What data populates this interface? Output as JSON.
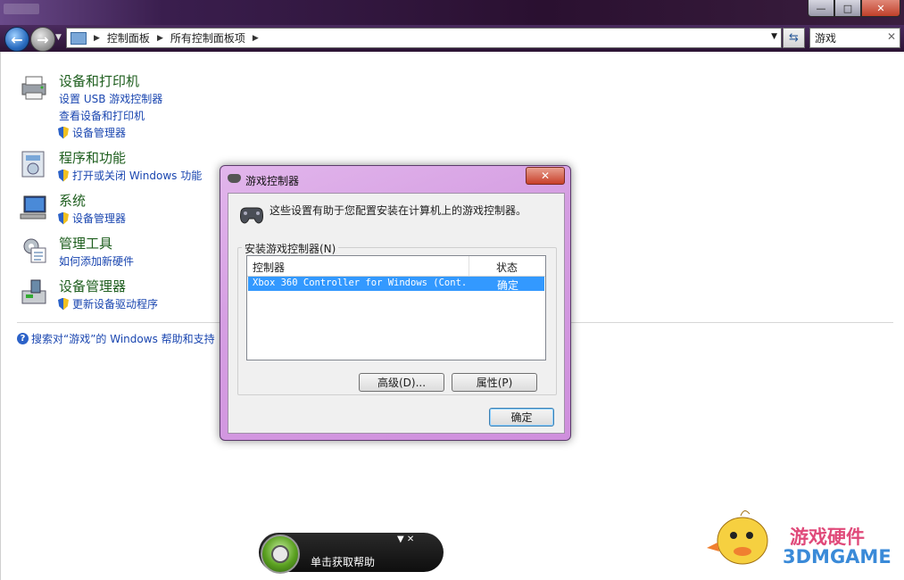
{
  "window": {
    "controls": {
      "minimize": "—",
      "maximize": "□",
      "close": "✕"
    }
  },
  "nav": {
    "back_icon": "back-arrow-icon",
    "forward_icon": "forward-arrow-icon",
    "breadcrumbs": [
      "控制面板",
      "所有控制面板项"
    ],
    "search_value": "游戏"
  },
  "categories": [
    {
      "title": "设备和打印机",
      "icon": "printer-icon",
      "links": [
        {
          "text": "设置 USB 游戏控制器",
          "shield": false
        },
        {
          "text": "查看设备和打印机",
          "shield": false
        },
        {
          "text": "设备管理器",
          "shield": true
        }
      ]
    },
    {
      "title": "程序和功能",
      "icon": "programs-icon",
      "links": [
        {
          "text": "打开或关闭 Windows 功能",
          "shield": true
        }
      ]
    },
    {
      "title": "系统",
      "icon": "computer-icon",
      "links": [
        {
          "text": "设备管理器",
          "shield": true
        }
      ]
    },
    {
      "title": "管理工具",
      "icon": "admin-tools-icon",
      "links": [
        {
          "text": "如何添加新硬件",
          "shield": false
        }
      ]
    },
    {
      "title": "设备管理器",
      "icon": "device-manager-icon",
      "links": [
        {
          "text": "更新设备驱动程序",
          "shield": true
        }
      ]
    }
  ],
  "help_search": "搜索对“游戏”的 Windows 帮助和支持",
  "dialog": {
    "title": "游戏控制器",
    "close": "✕",
    "description": "这些设置有助于您配置安装在计算机上的游戏控制器。",
    "group_label": "安装游戏控制器(N)",
    "columns": [
      "控制器",
      "状态"
    ],
    "rows": [
      {
        "controller": "Xbox 360 Controller for Windows (Cont...",
        "status": "确定"
      }
    ],
    "advanced_button": "高级(D)...",
    "properties_button": "属性(P)",
    "ok_button": "确定"
  },
  "help_pill": {
    "text": "单击获取帮助",
    "controls": "▼ ✕"
  },
  "watermark": {
    "line1": "游戏硬件",
    "line2": "3DMGAME"
  },
  "colors": {
    "accent_link": "#1a46b0",
    "category_title": "#1e5e1e",
    "selection": "#3399ff",
    "dialog_frame": "#d59ee2"
  }
}
